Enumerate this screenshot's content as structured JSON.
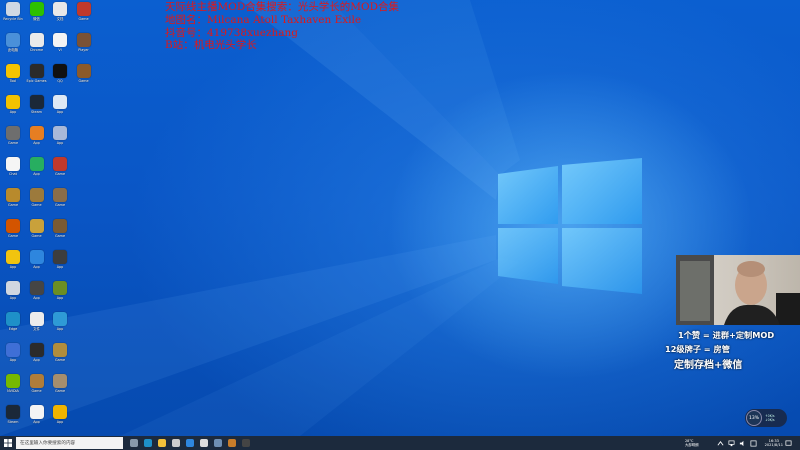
{
  "overlay": {
    "lines": [
      "天际线主播MOD合集搜索：光头学长的MOD合集",
      "地图名：Milcana Atoll Taxhaven Exile",
      "抖音号：419738xuezhang",
      "B站：机电光头学长"
    ]
  },
  "desktop_icons": [
    {
      "label": "Recycle Bin",
      "color": "#cfd8e3",
      "col": 0,
      "row": 0
    },
    {
      "label": "微信",
      "color": "#2dc100",
      "col": 1,
      "row": 0
    },
    {
      "label": "文档",
      "color": "#e8e8e8",
      "col": 2,
      "row": 0
    },
    {
      "label": "Game",
      "color": "#c0392b",
      "col": 3,
      "row": 0
    },
    {
      "label": "此电脑",
      "color": "#4a90d9",
      "col": 0,
      "row": 1
    },
    {
      "label": "Chrome",
      "color": "#eaeaea",
      "col": 1,
      "row": 1
    },
    {
      "label": "VI",
      "color": "#f4f4f4",
      "col": 2,
      "row": 1
    },
    {
      "label": "Player",
      "color": "#7a5236",
      "col": 3,
      "row": 1
    },
    {
      "label": "Tool",
      "color": "#f5c400",
      "col": 0,
      "row": 2
    },
    {
      "label": "Epic Games",
      "color": "#2b2b2b",
      "col": 1,
      "row": 2
    },
    {
      "label": "QQ",
      "color": "#111111",
      "col": 2,
      "row": 2
    },
    {
      "label": "Game",
      "color": "#8b5a2b",
      "col": 3,
      "row": 2
    },
    {
      "label": "App",
      "color": "#f2c200",
      "col": 0,
      "row": 3
    },
    {
      "label": "Steam",
      "color": "#1b2838",
      "col": 1,
      "row": 3
    },
    {
      "label": "App",
      "color": "#dde8f5",
      "col": 2,
      "row": 3
    },
    {
      "label": "Game",
      "color": "#6e6e6e",
      "col": 0,
      "row": 4
    },
    {
      "label": "App",
      "color": "#e67e22",
      "col": 1,
      "row": 4
    },
    {
      "label": "App",
      "color": "#a7b8d9",
      "col": 2,
      "row": 4
    },
    {
      "label": "Chat",
      "color": "#f5f5f5",
      "col": 0,
      "row": 5
    },
    {
      "label": "App",
      "color": "#27ae60",
      "col": 1,
      "row": 5
    },
    {
      "label": "Game",
      "color": "#c0392b",
      "col": 2,
      "row": 5
    },
    {
      "label": "Game",
      "color": "#b88a2c",
      "col": 0,
      "row": 6
    },
    {
      "label": "Game",
      "color": "#9c7a3c",
      "col": 1,
      "row": 6
    },
    {
      "label": "Game",
      "color": "#8a6d4a",
      "col": 2,
      "row": 6
    },
    {
      "label": "Game",
      "color": "#d35400",
      "col": 0,
      "row": 7
    },
    {
      "label": "Game",
      "color": "#c9a13b",
      "col": 1,
      "row": 7
    },
    {
      "label": "Game",
      "color": "#7b5a32",
      "col": 2,
      "row": 7
    },
    {
      "label": "App",
      "color": "#f1c40f",
      "col": 0,
      "row": 8
    },
    {
      "label": "App",
      "color": "#2e86de",
      "col": 1,
      "row": 8
    },
    {
      "label": "App",
      "color": "#3d3d3d",
      "col": 2,
      "row": 8
    },
    {
      "label": "App",
      "color": "#d0d7e0",
      "col": 0,
      "row": 9
    },
    {
      "label": "App",
      "color": "#454545",
      "col": 1,
      "row": 9
    },
    {
      "label": "App",
      "color": "#6b8e23",
      "col": 2,
      "row": 9
    },
    {
      "label": "Edge",
      "color": "#1e90c8",
      "col": 0,
      "row": 10
    },
    {
      "label": "文件",
      "color": "#ececec",
      "col": 1,
      "row": 10
    },
    {
      "label": "App",
      "color": "#2e9ad6",
      "col": 2,
      "row": 10
    },
    {
      "label": "App",
      "color": "#3f6fd6",
      "col": 0,
      "row": 11
    },
    {
      "label": "App",
      "color": "#2b2b2b",
      "col": 1,
      "row": 11
    },
    {
      "label": "Game",
      "color": "#b08d3c",
      "col": 2,
      "row": 11
    },
    {
      "label": "NVIDIA",
      "color": "#76b900",
      "col": 0,
      "row": 12
    },
    {
      "label": "Game",
      "color": "#b07d3a",
      "col": 1,
      "row": 12
    },
    {
      "label": "Game",
      "color": "#a58e6e",
      "col": 2,
      "row": 12
    },
    {
      "label": "Steam",
      "color": "#1b2838",
      "col": 0,
      "row": 13
    },
    {
      "label": "App",
      "color": "#f4f4f4",
      "col": 1,
      "row": 13
    },
    {
      "label": "App",
      "color": "#f0b400",
      "col": 2,
      "row": 13
    }
  ],
  "promo": {
    "line1": "1个赞 = 进群+定制MOD",
    "line2": "12级牌子 = 房管",
    "line3": "定制存档+微信"
  },
  "net_widget": {
    "percent": "13%",
    "up": "↑0K/s",
    "down": "↓0K/s"
  },
  "taskbar": {
    "search_placeholder": "在这里输入你要搜索的内容",
    "apps": [
      {
        "name": "task-view",
        "color": "#8899aa"
      },
      {
        "name": "edge",
        "color": "#1e90c8"
      },
      {
        "name": "file-explorer",
        "color": "#f3c13a"
      },
      {
        "name": "store",
        "color": "#cccccc"
      },
      {
        "name": "app-blue",
        "color": "#2e86de"
      },
      {
        "name": "steam",
        "color": "#dddddd"
      },
      {
        "name": "app-dark",
        "color": "#6f8fb3"
      },
      {
        "name": "app-game",
        "color": "#c87d2a"
      },
      {
        "name": "obs",
        "color": "#444444"
      }
    ],
    "weather_temp": "28°C",
    "weather_desc": "大部晴朗",
    "time": "16:33",
    "date": "2021/8/11"
  },
  "colors": {
    "overlay_text": "#e01818",
    "taskbar": "#1c2a3d",
    "desktop": "#0a57c4"
  }
}
